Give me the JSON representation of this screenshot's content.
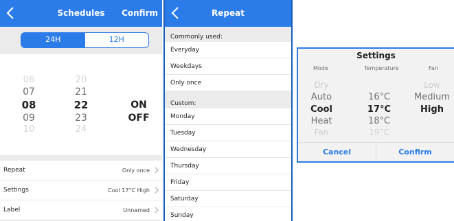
{
  "schedules": {
    "title": "Schedules",
    "confirm": "Confirm",
    "format_24": "24H",
    "format_12": "12H",
    "hours": [
      "06",
      "07",
      "08",
      "09",
      "10"
    ],
    "minutes": [
      "20",
      "21",
      "22",
      "23",
      "24"
    ],
    "onoff": [
      "ON",
      "OFF"
    ],
    "rows": [
      {
        "label": "Repeat",
        "value": "Only once"
      },
      {
        "label": "Settings",
        "value": "Cool 17°C High"
      },
      {
        "label": "Label",
        "value": "Unnamed"
      }
    ]
  },
  "repeat": {
    "title": "Repeat",
    "common_header": "Commonly used:",
    "common": [
      "Everyday",
      "Weekdays",
      "Only once"
    ],
    "custom_header": "Custom:",
    "custom": [
      "Monday",
      "Tuesday",
      "Wednesday",
      "Thursday",
      "Friday",
      "Saturday",
      "Sunday"
    ]
  },
  "settings": {
    "title": "Settings",
    "col_mode": "Mode",
    "col_temp": "Temperature",
    "col_fan": "Fan",
    "modes": [
      "Dry",
      "Auto",
      "Cool",
      "Heat",
      "Fan"
    ],
    "temps": [
      "16°C",
      "17°C",
      "18°C",
      "19°C"
    ],
    "fans": [
      "Low",
      "Medium",
      "High"
    ],
    "cancel": "Cancel",
    "confirm": "Confirm"
  },
  "colors": {
    "accent": "#2b7ce9",
    "background": "#ebebeb"
  }
}
